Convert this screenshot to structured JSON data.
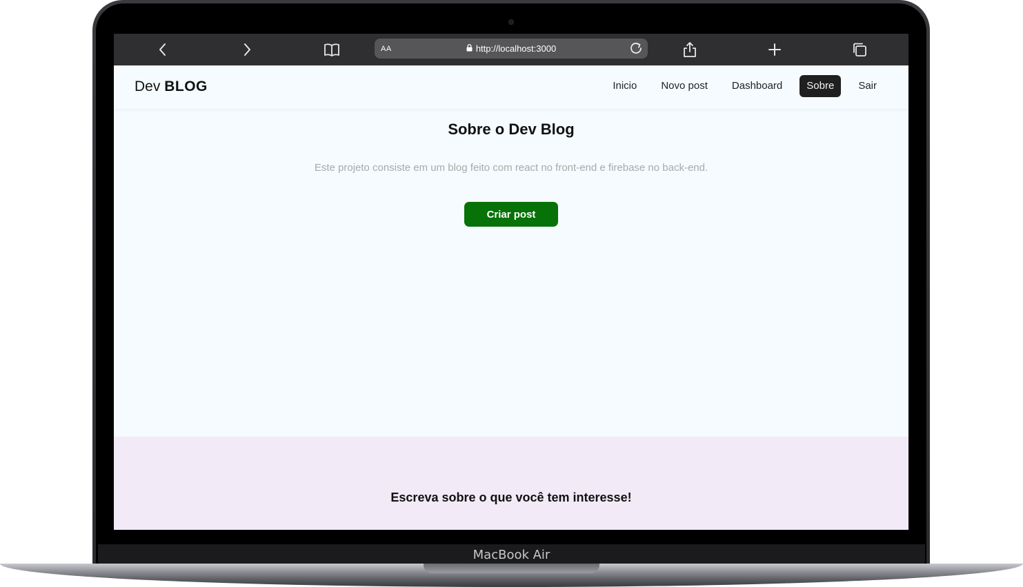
{
  "device": {
    "model_label": "MacBook Air"
  },
  "browser": {
    "text_size_label": "AA",
    "url": "http://localhost:3000",
    "icons": [
      "back-icon",
      "forward-icon",
      "bookmarks-icon",
      "lock-icon",
      "reload-icon",
      "share-icon",
      "new-tab-icon",
      "tabs-icon"
    ]
  },
  "site": {
    "brand_light": "Dev",
    "brand_bold": "BLOG",
    "nav": [
      {
        "label": "Inicio",
        "active": false
      },
      {
        "label": "Novo post",
        "active": false
      },
      {
        "label": "Dashboard",
        "active": false
      },
      {
        "label": "Sobre",
        "active": true
      },
      {
        "label": "Sair",
        "active": false
      }
    ]
  },
  "about": {
    "title": "Sobre o Dev Blog",
    "description": "Este projeto consiste em um blog feito com react no front-end e firebase no back-end.",
    "button_label": "Criar post"
  },
  "footer": {
    "text": "Escreva sobre o que você tem interesse!"
  },
  "colors": {
    "primary_button": "#077207",
    "active_nav_bg": "#1f1f1f",
    "page_bg": "#f5fbff",
    "footer_bg": "#f2eaf6"
  }
}
